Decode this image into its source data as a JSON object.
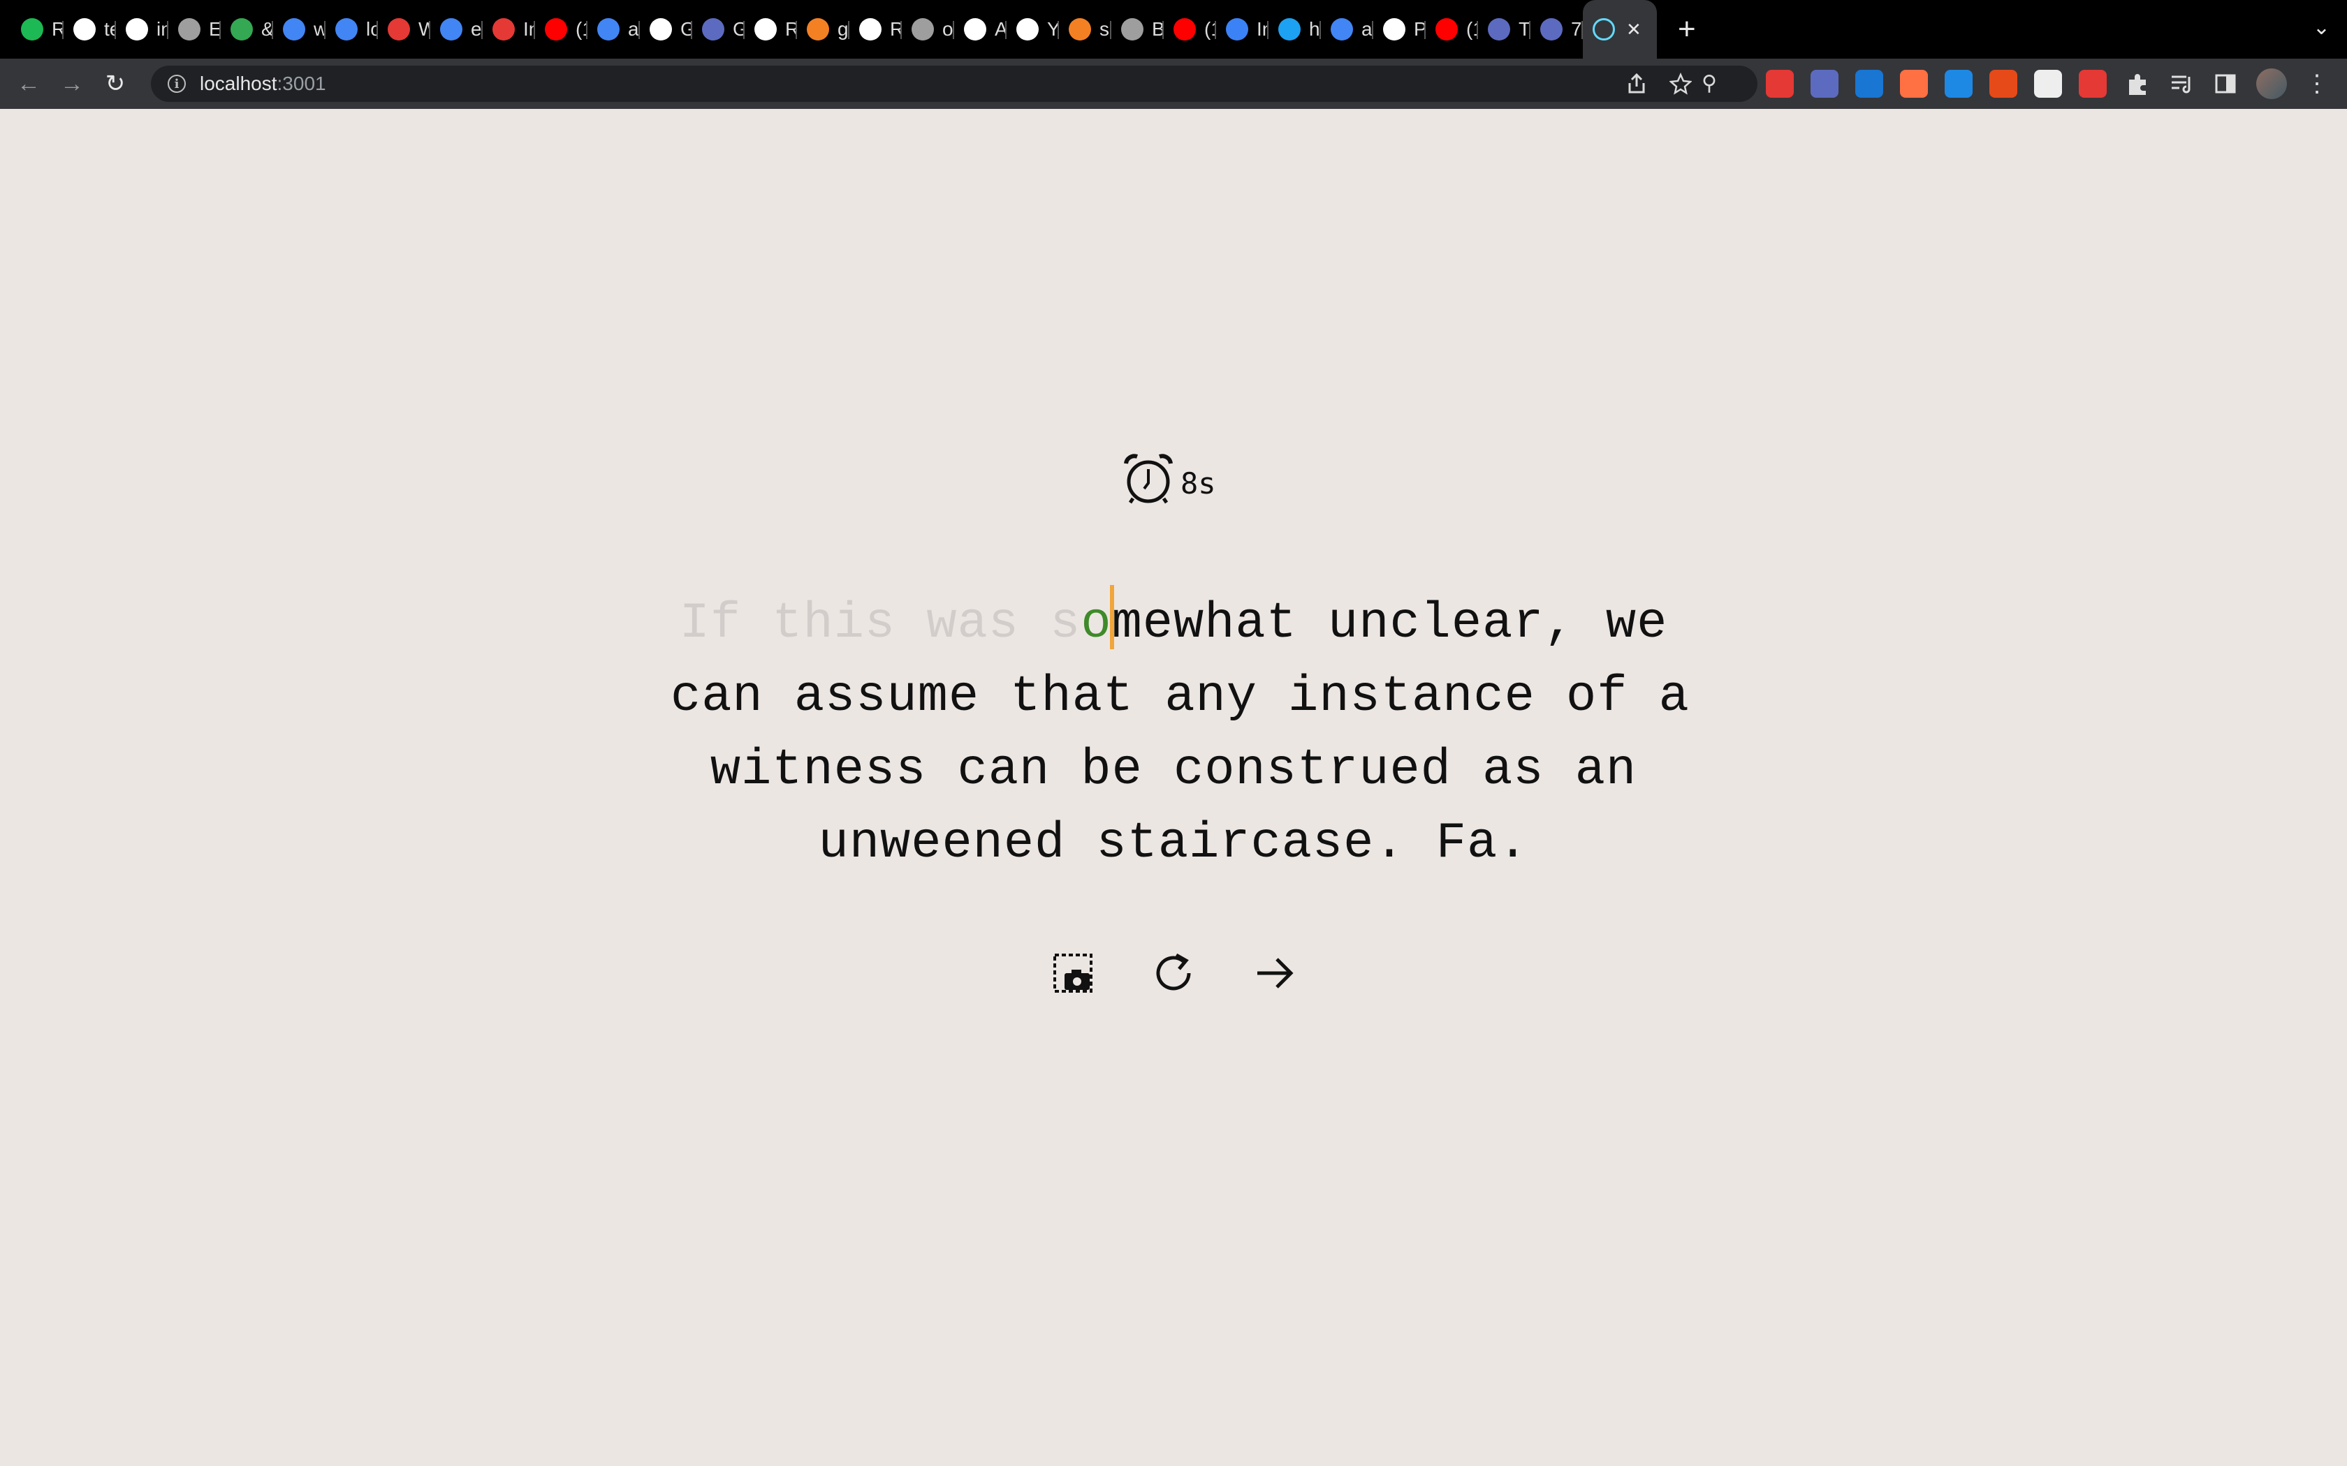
{
  "browser": {
    "tabs": [
      {
        "label": "R",
        "favicon": "w-logo-icon",
        "color": "#1db954"
      },
      {
        "label": "te",
        "favicon": "github-icon",
        "color": "#ffffff"
      },
      {
        "label": "in",
        "favicon": "triangle-icon",
        "color": "#ffffff"
      },
      {
        "label": "Er",
        "favicon": "globe-icon",
        "color": "#9e9e9e"
      },
      {
        "label": "&",
        "favicon": "gmail-icon",
        "color": "#34a853"
      },
      {
        "label": "w",
        "favicon": "google-icon",
        "color": "#4285f4"
      },
      {
        "label": "lo",
        "favicon": "google-icon",
        "color": "#4285f4"
      },
      {
        "label": "W",
        "favicon": "code-icon",
        "color": "#e53935"
      },
      {
        "label": "er",
        "favicon": "google-icon",
        "color": "#4285f4"
      },
      {
        "label": "In",
        "favicon": "gauge-icon",
        "color": "#e53935"
      },
      {
        "label": "(1",
        "favicon": "youtube-icon",
        "color": "#ff0000"
      },
      {
        "label": "ar",
        "favicon": "google-icon",
        "color": "#4285f4"
      },
      {
        "label": "G",
        "favicon": "github-icon",
        "color": "#ffffff"
      },
      {
        "label": "G",
        "favicon": "angular-icon",
        "color": "#5c6bc0"
      },
      {
        "label": "R",
        "favicon": "github-icon",
        "color": "#ffffff"
      },
      {
        "label": "gi",
        "favicon": "stackoverflow-icon",
        "color": "#f48024"
      },
      {
        "label": "R",
        "favicon": "github-icon",
        "color": "#ffffff"
      },
      {
        "label": "ov",
        "favicon": "globe-icon",
        "color": "#9e9e9e"
      },
      {
        "label": "A",
        "favicon": "github-icon",
        "color": "#ffffff"
      },
      {
        "label": "Yo",
        "favicon": "github-icon",
        "color": "#ffffff"
      },
      {
        "label": "su",
        "favicon": "stackoverflow-icon",
        "color": "#f48024"
      },
      {
        "label": "Bl",
        "favicon": "globe-icon",
        "color": "#9e9e9e"
      },
      {
        "label": "(1",
        "favicon": "youtube-icon",
        "color": "#ff0000"
      },
      {
        "label": "In",
        "favicon": "instagram-icon",
        "color": "#3b82f6"
      },
      {
        "label": "ht",
        "favicon": "twitter-icon",
        "color": "#1da1f2"
      },
      {
        "label": "ac",
        "favicon": "google-icon",
        "color": "#4285f4"
      },
      {
        "label": "Pr",
        "favicon": "triangle-icon",
        "color": "#ffffff"
      },
      {
        "label": "(1",
        "favicon": "youtube-icon",
        "color": "#ff0000"
      },
      {
        "label": "Te",
        "favicon": "diamond-icon",
        "color": "#5c6bc0"
      },
      {
        "label": "7",
        "favicon": "angular-icon",
        "color": "#5c6bc0"
      }
    ],
    "active_tab": {
      "favicon": "react-icon",
      "color": "#61dafb"
    },
    "url_host": "localhost",
    "url_port": ":3001",
    "extensions": [
      {
        "name": "ext-red-icon",
        "color": "#e53935"
      },
      {
        "name": "ext-pen-icon",
        "color": "#5c6bc0"
      },
      {
        "name": "ext-fi-icon",
        "color": "#1976d2"
      },
      {
        "name": "ext-orb-icon",
        "color": "#ff7043"
      },
      {
        "name": "ext-shield-icon",
        "color": "#1e88e5"
      },
      {
        "name": "ext-c-icon",
        "color": "#e64a19"
      },
      {
        "name": "ext-ball-icon",
        "color": "#eeeeee"
      },
      {
        "name": "ext-hand-icon",
        "color": "#e53935"
      }
    ]
  },
  "app": {
    "timer": "8s",
    "typed": "If this was s",
    "current": "o",
    "lines": [
      "mewhat unclear, we",
      "can assume that any instance of a",
      "witness can be construed as an",
      "unweened staircase. Fa."
    ],
    "colors": {
      "background": "#ece6e3",
      "typed": "#d2cdca",
      "correct": "#3f8a2a",
      "caret": "#f0a63a",
      "text": "#111111"
    }
  }
}
